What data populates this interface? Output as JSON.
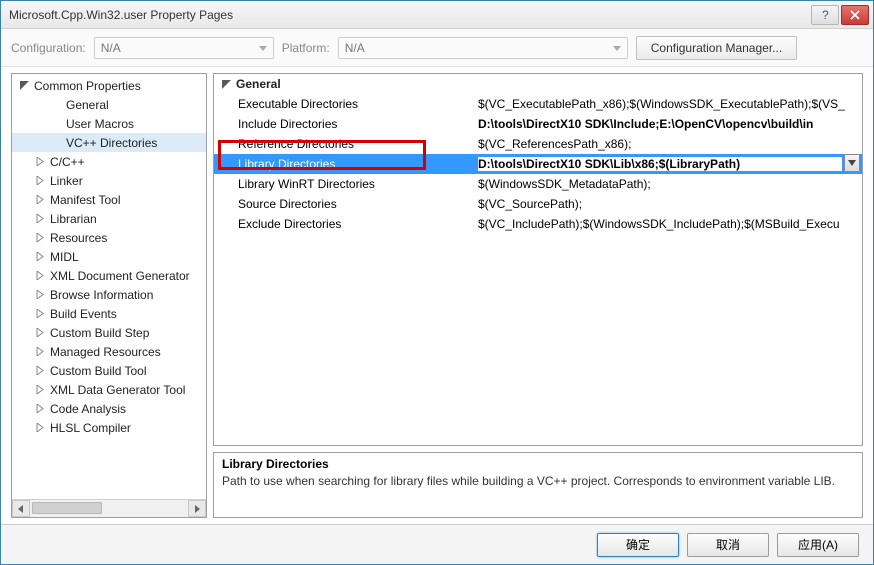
{
  "window": {
    "title": "Microsoft.Cpp.Win32.user Property Pages"
  },
  "toolbar": {
    "config_label": "Configuration:",
    "config_value": "N/A",
    "platform_label": "Platform:",
    "platform_value": "N/A",
    "config_mgr": "Configuration Manager..."
  },
  "tree": {
    "root": "Common Properties",
    "items": [
      {
        "label": "General",
        "expandable": false,
        "indent": 2
      },
      {
        "label": "User Macros",
        "expandable": false,
        "indent": 2
      },
      {
        "label": "VC++ Directories",
        "expandable": false,
        "indent": 2,
        "selected": true
      },
      {
        "label": "C/C++",
        "expandable": true,
        "indent": 1
      },
      {
        "label": "Linker",
        "expandable": true,
        "indent": 1
      },
      {
        "label": "Manifest Tool",
        "expandable": true,
        "indent": 1
      },
      {
        "label": "Librarian",
        "expandable": true,
        "indent": 1
      },
      {
        "label": "Resources",
        "expandable": true,
        "indent": 1
      },
      {
        "label": "MIDL",
        "expandable": true,
        "indent": 1
      },
      {
        "label": "XML Document Generator",
        "expandable": true,
        "indent": 1
      },
      {
        "label": "Browse Information",
        "expandable": true,
        "indent": 1
      },
      {
        "label": "Build Events",
        "expandable": true,
        "indent": 1
      },
      {
        "label": "Custom Build Step",
        "expandable": true,
        "indent": 1
      },
      {
        "label": "Managed Resources",
        "expandable": true,
        "indent": 1
      },
      {
        "label": "Custom Build Tool",
        "expandable": true,
        "indent": 1
      },
      {
        "label": "XML Data Generator Tool",
        "expandable": true,
        "indent": 1
      },
      {
        "label": "Code Analysis",
        "expandable": true,
        "indent": 1
      },
      {
        "label": "HLSL Compiler",
        "expandable": true,
        "indent": 1
      }
    ]
  },
  "grid": {
    "header": "General",
    "rows": [
      {
        "name": "Executable Directories",
        "value": "$(VC_ExecutablePath_x86);$(WindowsSDK_ExecutablePath);$(VS_"
      },
      {
        "name": "Include Directories",
        "value": "D:\\tools\\DirectX10 SDK\\Include;E:\\OpenCV\\opencv\\build\\in",
        "bold": true
      },
      {
        "name": "Reference Directories",
        "value": "$(VC_ReferencesPath_x86);"
      },
      {
        "name": "Library Directories",
        "value": "D:\\tools\\DirectX10 SDK\\Lib\\x86;$(LibraryPath)",
        "bold": true,
        "selected": true
      },
      {
        "name": "Library WinRT Directories",
        "value": "$(WindowsSDK_MetadataPath);"
      },
      {
        "name": "Source Directories",
        "value": "$(VC_SourcePath);"
      },
      {
        "name": "Exclude Directories",
        "value": "$(VC_IncludePath);$(WindowsSDK_IncludePath);$(MSBuild_Execu"
      }
    ]
  },
  "description": {
    "title": "Library Directories",
    "text": "Path to use when searching for library files while building a VC++ project.  Corresponds to environment variable LIB."
  },
  "buttons": {
    "ok": "确定",
    "cancel": "取消",
    "apply": "应用(A)"
  }
}
